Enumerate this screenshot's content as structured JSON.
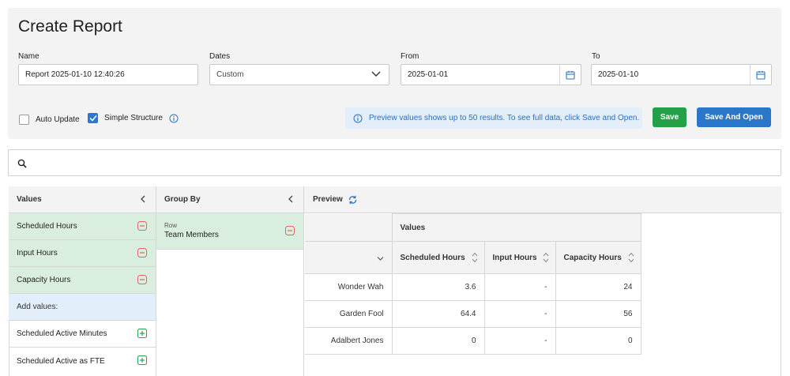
{
  "header": {
    "title": "Create Report",
    "name_label": "Name",
    "name_value": "Report 2025-01-10 12:40:26",
    "dates_label": "Dates",
    "dates_value": "Custom",
    "from_label": "From",
    "from_value": "2025-01-01",
    "to_label": "To",
    "to_value": "2025-01-10",
    "auto_update_label": "Auto Update",
    "auto_update_checked": false,
    "simple_structure_label": "Simple Structure",
    "simple_structure_checked": true,
    "notice": "Preview values shows up to 50 results. To see full data, click Save and Open.",
    "save_label": "Save",
    "save_open_label": "Save And Open"
  },
  "values_panel": {
    "title": "Values",
    "selected": [
      "Scheduled Hours",
      "Input Hours",
      "Capacity Hours"
    ],
    "add_label": "Add values:",
    "available": [
      "Scheduled Active Minutes",
      "Scheduled Active as FTE"
    ]
  },
  "group_panel": {
    "title": "Group By",
    "row_sub": "Row",
    "row_value": "Team Members"
  },
  "preview": {
    "title": "Preview",
    "values_header": "Values",
    "columns": [
      "Scheduled Hours",
      "Input Hours",
      "Capacity Hours"
    ],
    "rows": [
      {
        "name": "Wonder Wah",
        "cells": [
          "3.6",
          "-",
          "24"
        ]
      },
      {
        "name": "Garden Fool",
        "cells": [
          "64.4",
          "-",
          "56"
        ]
      },
      {
        "name": "Adalbert Jones",
        "cells": [
          "0",
          "-",
          "0"
        ]
      }
    ]
  },
  "colors": {
    "accent_blue": "#2a76c9",
    "save_green": "#24a148",
    "selected_green_bg": "#d9eede",
    "remove_red": "#e06666",
    "add_green": "#2e9e4f"
  }
}
